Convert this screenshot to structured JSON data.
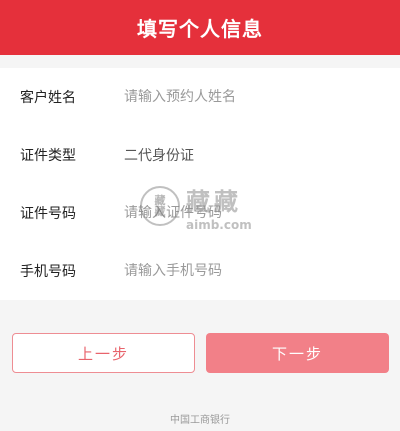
{
  "header": {
    "title": "填写个人信息"
  },
  "form": {
    "rows": [
      {
        "label": "客户姓名",
        "placeholder": "请输入预约人姓名"
      },
      {
        "label": "证件类型",
        "value": "二代身份证"
      },
      {
        "label": "证件号码",
        "placeholder": "请输入证件号码"
      },
      {
        "label": "手机号码",
        "placeholder": "请输入手机号码"
      }
    ]
  },
  "buttons": {
    "prev_label": "上一步",
    "next_label": "下一步"
  },
  "watermark": {
    "seal_text": "藏\n藏",
    "brand": "藏藏",
    "url": "aimb.com"
  },
  "footer": {
    "text": "中国工商银行"
  },
  "colors": {
    "header_bg": "#e5303b",
    "next_bg": "#f28088",
    "prev_border": "#ee8d93",
    "prev_text": "#e8646c"
  }
}
